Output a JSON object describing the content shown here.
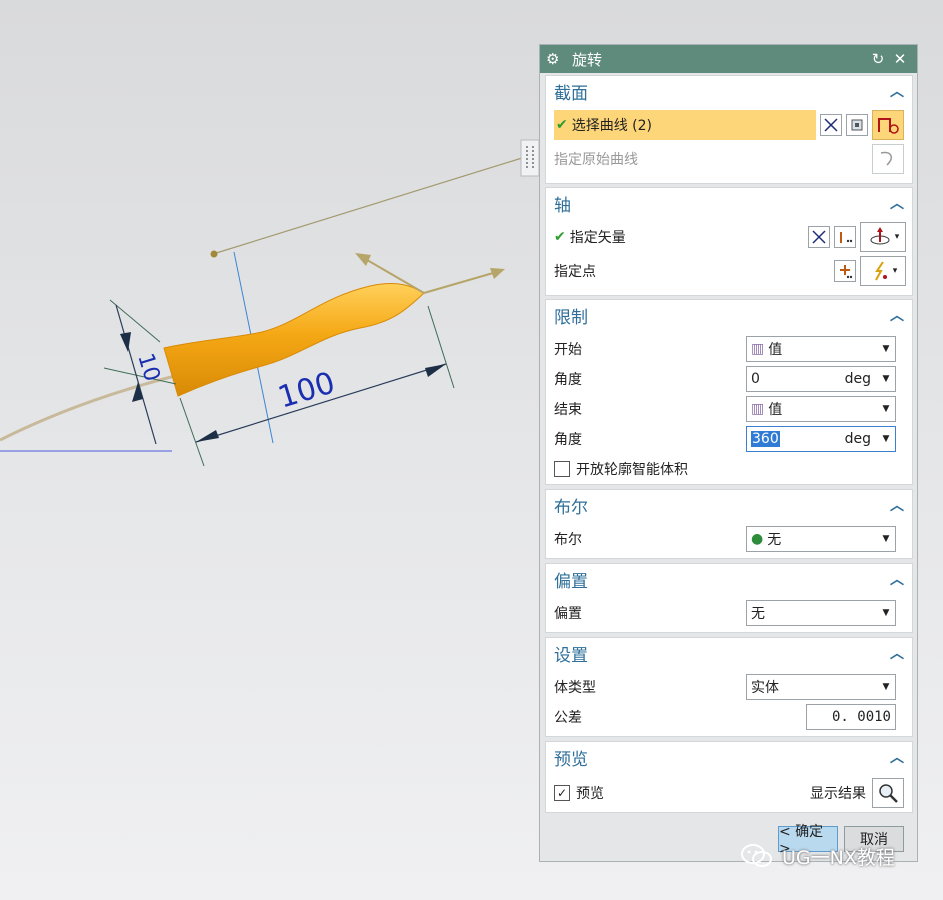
{
  "dialog": {
    "title": "旋转",
    "icons": {
      "settings": "gear-icon",
      "reset": "reset-icon",
      "close": "close-icon"
    },
    "sections": {
      "section": {
        "title": "截面",
        "select_curve": "选择曲线 (2)",
        "specify_origin_curve": "指定原始曲线"
      },
      "axis": {
        "title": "轴",
        "specify_vector": "指定矢量",
        "specify_point": "指定点"
      },
      "limits": {
        "title": "限制",
        "start_label": "开始",
        "start_value": "值",
        "start_angle_label": "角度",
        "start_angle": "0",
        "start_unit": "deg",
        "end_label": "结束",
        "end_value": "值",
        "end_angle_label": "角度",
        "end_angle": "360",
        "end_unit": "deg",
        "open_profile": "开放轮廓智能体积"
      },
      "boolean": {
        "title": "布尔",
        "label": "布尔",
        "value": "无"
      },
      "offset": {
        "title": "偏置",
        "label": "偏置",
        "value": "无"
      },
      "settings": {
        "title": "设置",
        "body_type_label": "体类型",
        "body_type": "实体",
        "tolerance_label": "公差",
        "tolerance": "0. 0010"
      },
      "preview": {
        "title": "预览",
        "preview_label": "预览",
        "show_result": "显示结果"
      }
    },
    "buttons": {
      "ok": "< 确定 >",
      "cancel": "取消"
    }
  },
  "model": {
    "dim_length": "100",
    "dim_diameter": "10"
  },
  "watermark": "UG一NX教程",
  "colors": {
    "titlebar": "#5e8b7b",
    "section_title": "#2f6f9a",
    "highlight_row": "#fdd679",
    "solid_body": "#f5a815",
    "dimension_line": "#1a2fb0"
  }
}
